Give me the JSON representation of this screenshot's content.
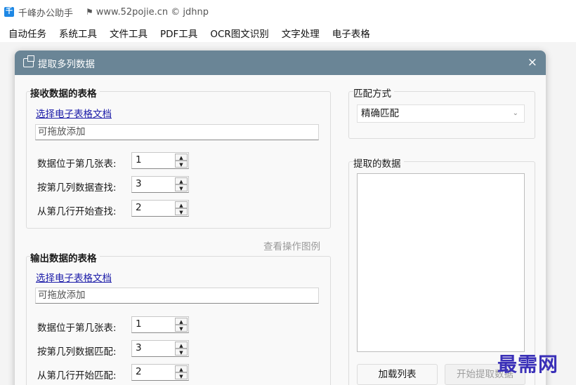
{
  "app": {
    "title": "千峰办公助手",
    "website": "www.52pojie.cn © jdhnp",
    "logo_char": "千"
  },
  "menu": [
    "自动任务",
    "系统工具",
    "文件工具",
    "PDF工具",
    "OCR图文识别",
    "文字处理",
    "电子表格"
  ],
  "dialog": {
    "title": "提取多列数据",
    "close": "×",
    "receive": {
      "title": "接收数据的表格",
      "choose_link": "选择电子表格文档",
      "drop_placeholder": "可拖放添加",
      "rows": [
        {
          "label": "数据位于第几张表:",
          "value": "1"
        },
        {
          "label": "按第几列数据查找:",
          "value": "3"
        },
        {
          "label": "从第几行开始查找:",
          "value": "2"
        }
      ]
    },
    "example_hint": "查看操作图例",
    "output": {
      "title": "输出数据的表格",
      "choose_link": "选择电子表格文档",
      "drop_placeholder": "可拖放添加",
      "rows": [
        {
          "label": "数据位于第几张表:",
          "value": "1"
        },
        {
          "label": "按第几列数据匹配:",
          "value": "3"
        },
        {
          "label": "从第几行开始匹配:",
          "value": "2"
        }
      ]
    },
    "match": {
      "title": "匹配方式",
      "selected": "精确匹配"
    },
    "extracted": {
      "title": "提取的数据"
    },
    "buttons": {
      "load": "加载列表",
      "start": "开始提取数据"
    }
  },
  "watermark": "最需网",
  "colors": {
    "dialog_header": "#6a8596",
    "link": "#1a1aa8",
    "watermark": "#3a30b8"
  }
}
